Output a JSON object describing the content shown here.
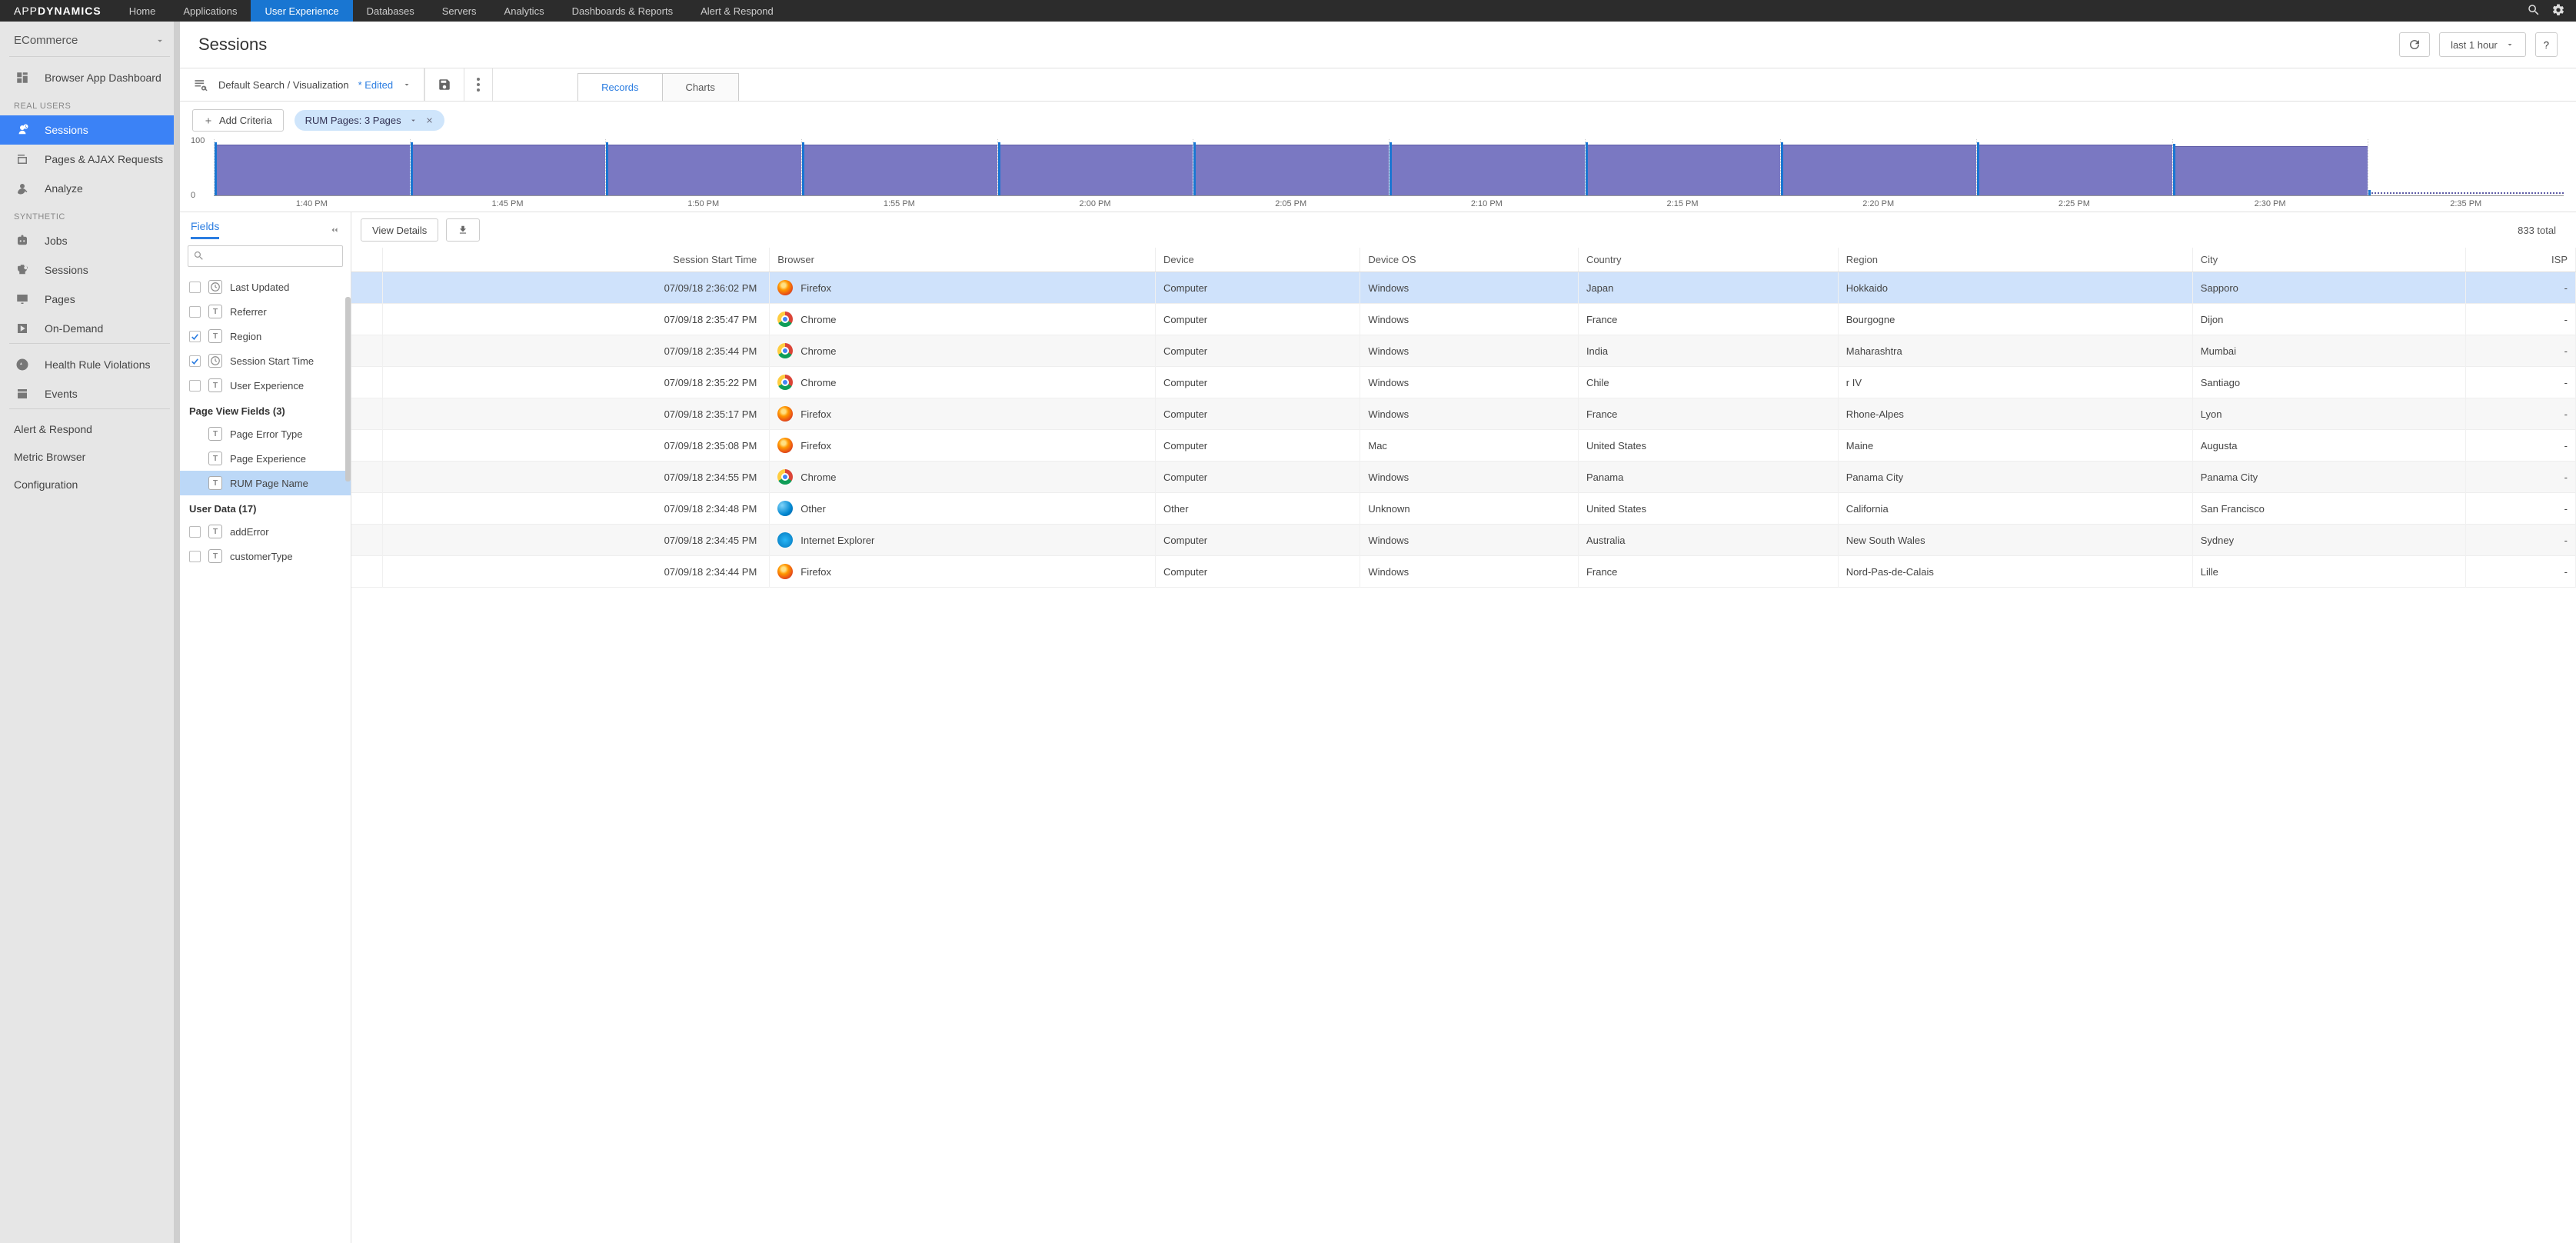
{
  "brand": {
    "part1": "APP",
    "part2": "DYNAMICS"
  },
  "topnav": {
    "items": [
      "Home",
      "Applications",
      "User Experience",
      "Databases",
      "Servers",
      "Analytics",
      "Dashboards & Reports",
      "Alert & Respond"
    ],
    "activeIndex": 2
  },
  "sidebar": {
    "header": "ECommerce",
    "preItems": [
      {
        "label": "Browser App Dashboard",
        "icon": "dashboard"
      }
    ],
    "sections": [
      {
        "title": "REAL USERS",
        "items": [
          {
            "label": "Sessions",
            "icon": "person-clock",
            "active": true
          },
          {
            "label": "Pages & AJAX Requests",
            "icon": "pages"
          },
          {
            "label": "Analyze",
            "icon": "person-search"
          }
        ]
      },
      {
        "title": "SYNTHETIC",
        "items": [
          {
            "label": "Jobs",
            "icon": "robot"
          },
          {
            "label": "Sessions",
            "icon": "robot-clock"
          },
          {
            "label": "Pages",
            "icon": "monitor"
          },
          {
            "label": "On-Demand",
            "icon": "play"
          }
        ]
      }
    ],
    "postItems": [
      {
        "label": "Health Rule Violations",
        "icon": "health"
      },
      {
        "label": "Events",
        "icon": "events"
      }
    ],
    "footerItems": [
      {
        "label": "Alert & Respond"
      },
      {
        "label": "Metric Browser"
      },
      {
        "label": "Configuration"
      }
    ]
  },
  "page": {
    "title": "Sessions"
  },
  "timeRange": {
    "label": "last 1 hour"
  },
  "helpLabel": "?",
  "searchBar": {
    "name": "Default Search / Visualization",
    "edited": "* Edited"
  },
  "tabs": {
    "items": [
      "Records",
      "Charts"
    ],
    "activeIndex": 0
  },
  "criteria": {
    "addLabel": "Add Criteria",
    "chipLabel": "RUM Pages: 3 Pages"
  },
  "chart_data": {
    "type": "bar",
    "categories": [
      "1:40 PM",
      "1:45 PM",
      "1:50 PM",
      "1:55 PM",
      "2:00 PM",
      "2:05 PM",
      "2:10 PM",
      "2:15 PM",
      "2:20 PM",
      "2:25 PM",
      "2:30 PM",
      "2:35 PM"
    ],
    "values": [
      90,
      90,
      90,
      90,
      90,
      90,
      90,
      90,
      90,
      90,
      88,
      5
    ],
    "dotted_last": true,
    "ylabel": "",
    "ylim": [
      0,
      100
    ],
    "yticks": [
      0,
      100
    ]
  },
  "fieldsPanel": {
    "tabLabel": "Fields",
    "searchPlaceholder": "",
    "groups": [
      {
        "title": null,
        "items": [
          {
            "label": "Last Updated",
            "checked": false,
            "type": "clock"
          },
          {
            "label": "Referrer",
            "checked": false,
            "type": "T"
          },
          {
            "label": "Region",
            "checked": true,
            "type": "T"
          },
          {
            "label": "Session Start Time",
            "checked": true,
            "type": "clock"
          },
          {
            "label": "User Experience",
            "checked": false,
            "type": "T"
          }
        ]
      },
      {
        "title": "Page View Fields (3)",
        "items": [
          {
            "label": "Page Error Type",
            "checked": null,
            "type": "T"
          },
          {
            "label": "Page Experience",
            "checked": null,
            "type": "T"
          },
          {
            "label": "RUM Page Name",
            "checked": null,
            "type": "T",
            "selected": true
          }
        ]
      },
      {
        "title": "User Data (17)",
        "items": [
          {
            "label": "addError",
            "checked": false,
            "type": "T"
          },
          {
            "label": "customerType",
            "checked": false,
            "type": "T"
          }
        ]
      }
    ]
  },
  "dataArea": {
    "viewDetails": "View Details",
    "total": "833 total",
    "columns": [
      "",
      "Session Start Time",
      "Browser",
      "Device",
      "Device OS",
      "Country",
      "Region",
      "City",
      "ISP"
    ],
    "rows": [
      {
        "start": "07/09/18 2:36:02 PM",
        "browser": "Firefox",
        "bicon": "firefox",
        "device": "Computer",
        "os": "Windows",
        "country": "Japan",
        "region": "Hokkaido",
        "city": "Sapporo",
        "isp": "-",
        "selected": true
      },
      {
        "start": "07/09/18 2:35:47 PM",
        "browser": "Chrome",
        "bicon": "chrome",
        "device": "Computer",
        "os": "Windows",
        "country": "France",
        "region": "Bourgogne",
        "city": "Dijon",
        "isp": "-"
      },
      {
        "start": "07/09/18 2:35:44 PM",
        "browser": "Chrome",
        "bicon": "chrome",
        "device": "Computer",
        "os": "Windows",
        "country": "India",
        "region": "Maharashtra",
        "city": "Mumbai",
        "isp": "-",
        "alt": true
      },
      {
        "start": "07/09/18 2:35:22 PM",
        "browser": "Chrome",
        "bicon": "chrome",
        "device": "Computer",
        "os": "Windows",
        "country": "Chile",
        "region": "r IV",
        "city": "Santiago",
        "isp": "-"
      },
      {
        "start": "07/09/18 2:35:17 PM",
        "browser": "Firefox",
        "bicon": "firefox",
        "device": "Computer",
        "os": "Windows",
        "country": "France",
        "region": "Rhone-Alpes",
        "city": "Lyon",
        "isp": "-",
        "alt": true
      },
      {
        "start": "07/09/18 2:35:08 PM",
        "browser": "Firefox",
        "bicon": "firefox",
        "device": "Computer",
        "os": "Mac",
        "country": "United States",
        "region": "Maine",
        "city": "Augusta",
        "isp": "-"
      },
      {
        "start": "07/09/18 2:34:55 PM",
        "browser": "Chrome",
        "bicon": "chrome",
        "device": "Computer",
        "os": "Windows",
        "country": "Panama",
        "region": "Panama City",
        "city": "Panama City",
        "isp": "-",
        "alt": true
      },
      {
        "start": "07/09/18 2:34:48 PM",
        "browser": "Other",
        "bicon": "other",
        "device": "Other",
        "os": "Unknown",
        "country": "United States",
        "region": "California",
        "city": "San Francisco",
        "isp": "-"
      },
      {
        "start": "07/09/18 2:34:45 PM",
        "browser": "Internet Explorer",
        "bicon": "ie",
        "device": "Computer",
        "os": "Windows",
        "country": "Australia",
        "region": "New South Wales",
        "city": "Sydney",
        "isp": "-",
        "alt": true
      },
      {
        "start": "07/09/18 2:34:44 PM",
        "browser": "Firefox",
        "bicon": "firefox",
        "device": "Computer",
        "os": "Windows",
        "country": "France",
        "region": "Nord-Pas-de-Calais",
        "city": "Lille",
        "isp": "-"
      }
    ]
  }
}
